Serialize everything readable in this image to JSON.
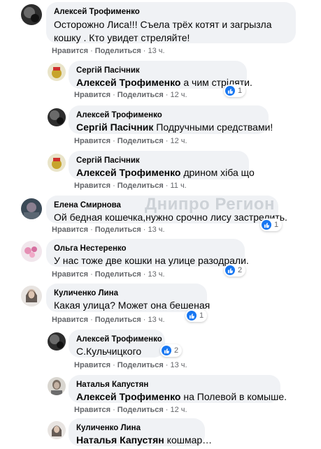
{
  "actions": {
    "like": "Нравится",
    "reply": "Поделиться"
  },
  "watermark": "Днипро Регион",
  "colors": {
    "bubble": "#f0f2f5",
    "link": "#65676b",
    "like": "#1877f2"
  },
  "comments": [
    {
      "author": "Алексей Трофименко",
      "text": "Осторожно Лиса!!! Съела трёх котят и загрызла кошку . Кто увидет стреляйте!",
      "time": "13 ч."
    },
    {
      "author": "Сергій Пасічник",
      "mention": "Алексей Трофименко",
      "text": "а чим стріляти.",
      "time": "12 ч.",
      "reactions": "1"
    },
    {
      "author": "Алексей Трофименко",
      "mention": "Сергій Пасічник",
      "text": "Подручными средствами!",
      "time": "12 ч."
    },
    {
      "author": "Сергій Пасічник",
      "mention": "Алексей Трофименко",
      "text": "дрином хіба що",
      "time": "11 ч."
    },
    {
      "author": "Елена Смирнова",
      "text": "Ой бедная кошечка,нужно срочно лису застрелить.",
      "time": "13 ч.",
      "reactions": "1"
    },
    {
      "author": "Ольга Нестеренко",
      "text": "У нас тоже две кошки на улице разодрали.",
      "time": "13 ч.",
      "reactions": "2"
    },
    {
      "author": "Куличенко Лина",
      "text": "Какая улица? Может она бешеная",
      "time": "13 ч.",
      "reactions": "1"
    },
    {
      "author": "Алексей Трофименко",
      "text": "С.Кульчицкого",
      "time": "13 ч.",
      "reactions": "2"
    },
    {
      "author": "Наталья Капустян",
      "mention": "Алексей Трофименко",
      "text": "на Полевой в комыше.",
      "time": "12 ч."
    },
    {
      "author": "Куличенко Лина",
      "mention": "Наталья Капустян",
      "text": "кошмар…"
    }
  ]
}
